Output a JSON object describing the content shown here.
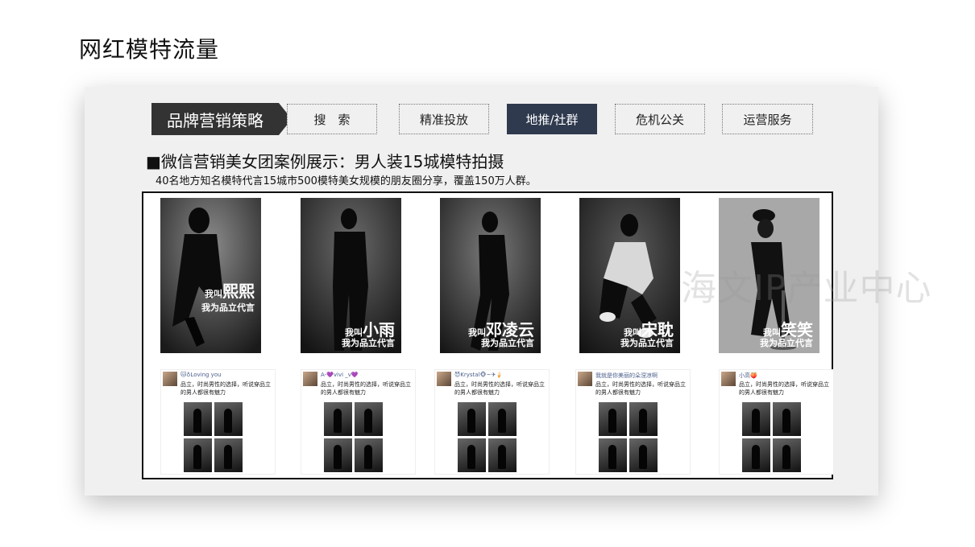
{
  "page": {
    "title": "网红模特流量"
  },
  "nav": {
    "brand": "品牌营销策略",
    "tabs": [
      {
        "label": "搜　索",
        "active": false
      },
      {
        "label": "精准投放",
        "active": false
      },
      {
        "label": "地推/社群",
        "active": true
      },
      {
        "label": "危机公关",
        "active": false
      },
      {
        "label": "运营服务",
        "active": false
      }
    ]
  },
  "content": {
    "heading": "■微信营销美女团案例展示：男人装15城模特拍摄",
    "subheading": "40名地方知名模特代言15城市500模特美女规模的朋友圈分享，覆盖150万人群。"
  },
  "models": [
    {
      "prefix": "我叫",
      "name": "熙熙",
      "slogan": "我为品立代言"
    },
    {
      "prefix": "我叫",
      "name": "小雨",
      "slogan": "我为品立代言"
    },
    {
      "prefix": "我叫",
      "name": "邓凌云",
      "slogan": "我为品立代言"
    },
    {
      "prefix": "我叫",
      "name": "宋耽",
      "slogan": "我为品立代言"
    },
    {
      "prefix": "我叫",
      "name": "笑笑",
      "slogan": "我为品立代言"
    }
  ],
  "posts": [
    {
      "user": "🐱♁Loving you",
      "text": "品立，时尚男性的选择，听说穿品立的男人都很有魅力"
    },
    {
      "user": "A-💜vivi _v💜",
      "text": "品立，时尚男性的选择，听说穿品立的男人都很有魅力"
    },
    {
      "user": "😈Krystal🐵~✈🍦",
      "text": "品立，时尚男性的选择，听说穿品立的男人都很有魅力"
    },
    {
      "user": "我就是你美丽的朵涅凉啊",
      "text": "品立，时尚男性的选择，听说穿品立的男人都很有魅力"
    },
    {
      "user": "小高🍑",
      "text": "品立，时尚男性的选择，听说穿品立的男人都很有魅力"
    }
  ],
  "watermark": "海文IP产业中心"
}
